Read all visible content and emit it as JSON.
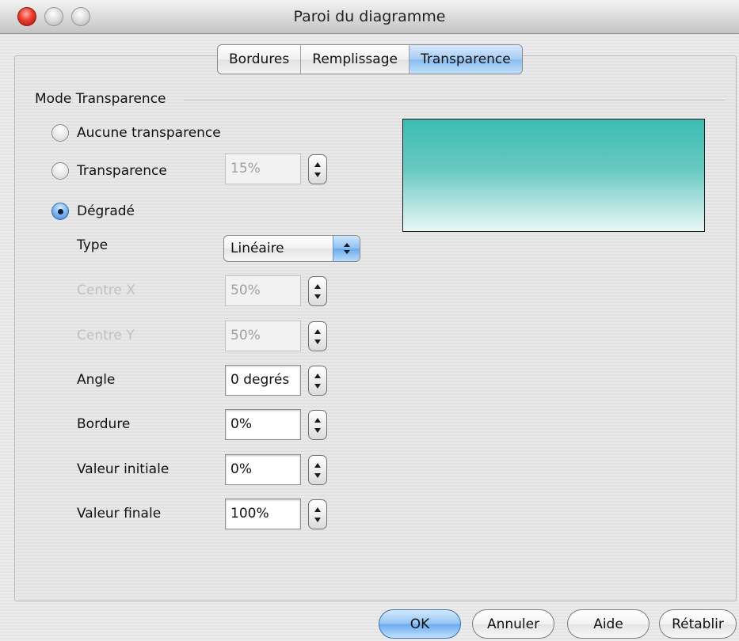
{
  "window": {
    "title": "Paroi du diagramme"
  },
  "tabs": [
    {
      "label": "Bordures",
      "active": false
    },
    {
      "label": "Remplissage",
      "active": false
    },
    {
      "label": "Transparence",
      "active": true
    }
  ],
  "mode": {
    "group_label": "Mode Transparence",
    "options": [
      {
        "label": "Aucune transparence",
        "checked": false
      },
      {
        "label": "Transparence",
        "checked": false
      },
      {
        "label": "Dégradé",
        "checked": true
      }
    ],
    "transparency_value": "15%"
  },
  "gradient": {
    "type_label": "Type",
    "type_value": "Linéaire",
    "center_x_label": "Centre X",
    "center_x_value": "50%",
    "center_y_label": "Centre Y",
    "center_y_value": "50%",
    "angle_label": "Angle",
    "angle_value": "0 degrés",
    "border_label": "Bordure",
    "border_value": "0%",
    "start_label": "Valeur initiale",
    "start_value": "0%",
    "end_label": "Valeur finale",
    "end_value": "100%"
  },
  "preview": {
    "color_top": "#3dbcb2",
    "color_bottom": "#e8f7f6"
  },
  "buttons": {
    "ok": "OK",
    "cancel": "Annuler",
    "help": "Aide",
    "reset": "Rétablir"
  },
  "colors": {
    "accent": "#89bbef",
    "close_button": "#ea3a2a"
  }
}
